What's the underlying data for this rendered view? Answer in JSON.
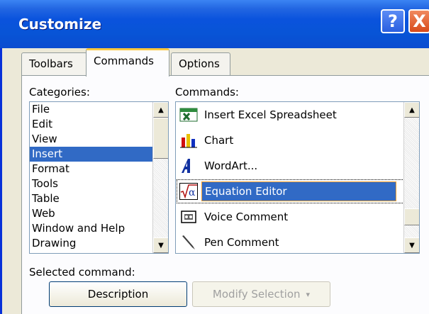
{
  "window": {
    "title": "Customize",
    "help_label": "?",
    "close_label": "X"
  },
  "tabs": [
    {
      "label": "Toolbars",
      "active": false
    },
    {
      "label": "Commands",
      "active": true
    },
    {
      "label": "Options",
      "active": false
    }
  ],
  "categories": {
    "label": "Categories:",
    "items": [
      "File",
      "Edit",
      "View",
      "Insert",
      "Format",
      "Tools",
      "Table",
      "Web",
      "Window and Help",
      "Drawing"
    ],
    "selected": "Insert"
  },
  "commands": {
    "label": "Commands:",
    "items": [
      {
        "label": "Insert Excel Spreadsheet",
        "icon": "excel-icon"
      },
      {
        "label": "Chart",
        "icon": "chart-icon"
      },
      {
        "label": "WordArt...",
        "icon": "wordart-icon"
      },
      {
        "label": "Equation Editor",
        "icon": "equation-icon"
      },
      {
        "label": "Voice Comment",
        "icon": "voice-comment-icon"
      },
      {
        "label": "Pen Comment",
        "icon": "pen-comment-icon"
      }
    ],
    "selected": "Equation Editor"
  },
  "selected_command": {
    "label": "Selected command:",
    "description_button": "Description",
    "modify_button": "Modify Selection",
    "modify_arrow": "▾"
  },
  "colors": {
    "selection": "#316ac5",
    "title_bar": "#0a53dd",
    "focus_border": "#f0a030"
  }
}
